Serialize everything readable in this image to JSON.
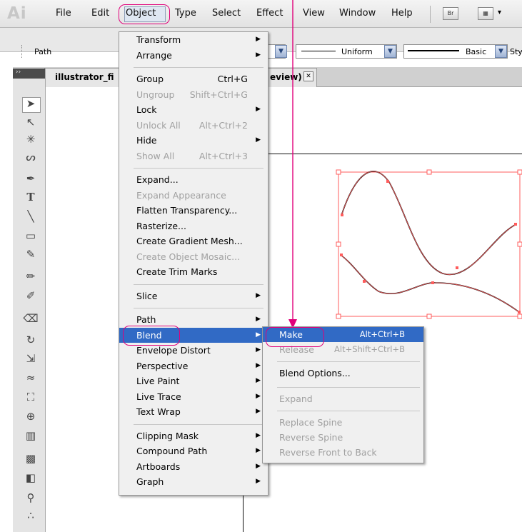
{
  "app": {
    "logo": "Ai",
    "menus": [
      "File",
      "Edit",
      "Object",
      "Type",
      "Select",
      "Effect",
      "View",
      "Window",
      "Help"
    ],
    "bridge_button": "Br",
    "arrange_button": "▾"
  },
  "control_bar": {
    "selection_type": "Path",
    "stroke_profile": "Uniform",
    "brush": "Basic",
    "style_label": "Styl"
  },
  "document": {
    "tab_title": "illustrator_fi",
    "tab_suffix": "eview)",
    "close_glyph": "✕"
  },
  "object_menu": {
    "items": [
      {
        "label": "Transform",
        "submenu": true
      },
      {
        "label": "Arrange",
        "submenu": true
      },
      {
        "label": "Group",
        "shortcut": "Ctrl+G"
      },
      {
        "label": "Ungroup",
        "shortcut": "Shift+Ctrl+G",
        "disabled": true
      },
      {
        "label": "Lock",
        "submenu": true
      },
      {
        "label": "Unlock All",
        "shortcut": "Alt+Ctrl+2",
        "disabled": true
      },
      {
        "label": "Hide",
        "submenu": true
      },
      {
        "label": "Show All",
        "shortcut": "Alt+Ctrl+3",
        "disabled": true
      },
      {
        "label": "Expand..."
      },
      {
        "label": "Expand Appearance",
        "disabled": true
      },
      {
        "label": "Flatten Transparency..."
      },
      {
        "label": "Rasterize..."
      },
      {
        "label": "Create Gradient Mesh..."
      },
      {
        "label": "Create Object Mosaic...",
        "disabled": true
      },
      {
        "label": "Create Trim Marks"
      },
      {
        "label": "Slice",
        "submenu": true
      },
      {
        "label": "Path",
        "submenu": true
      },
      {
        "label": "Blend",
        "submenu": true,
        "highlighted": true
      },
      {
        "label": "Envelope Distort",
        "submenu": true
      },
      {
        "label": "Perspective",
        "submenu": true
      },
      {
        "label": "Live Paint",
        "submenu": true
      },
      {
        "label": "Live Trace",
        "submenu": true
      },
      {
        "label": "Text Wrap",
        "submenu": true
      },
      {
        "label": "Clipping Mask",
        "submenu": true
      },
      {
        "label": "Compound Path",
        "submenu": true
      },
      {
        "label": "Artboards",
        "submenu": true
      },
      {
        "label": "Graph",
        "submenu": true
      }
    ]
  },
  "blend_menu": {
    "items": [
      {
        "label": "Make",
        "shortcut": "Alt+Ctrl+B",
        "highlighted": true
      },
      {
        "label": "Release",
        "shortcut": "Alt+Shift+Ctrl+B",
        "disabled": true
      },
      {
        "label": "Blend Options..."
      },
      {
        "label": "Expand",
        "disabled": true
      },
      {
        "label": "Replace Spine",
        "disabled": true
      },
      {
        "label": "Reverse Spine",
        "disabled": true
      },
      {
        "label": "Reverse Front to Back",
        "disabled": true
      }
    ]
  },
  "colors": {
    "highlight": "#316ac5",
    "annotation": "#e0007a",
    "selection_path": "#ff5c5c"
  }
}
